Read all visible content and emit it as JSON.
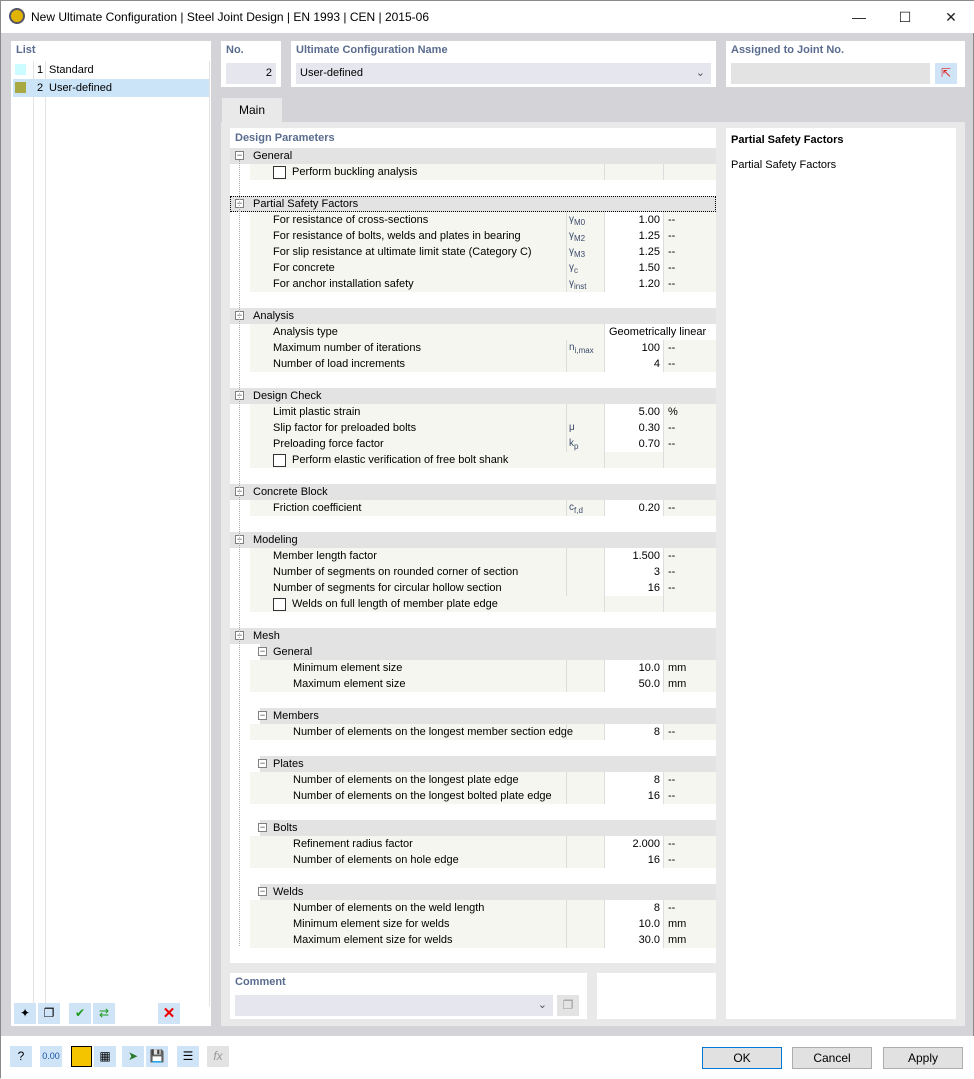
{
  "window": {
    "title": "New Ultimate Configuration | Steel Joint Design | EN 1993 | CEN | 2015-06",
    "minimize": "—",
    "maximize": "☐",
    "close": "✕"
  },
  "list": {
    "header": "List",
    "items": [
      {
        "no": "1",
        "name": "Standard",
        "color": "#ccfcff"
      },
      {
        "no": "2",
        "name": "User-defined",
        "color": "#a9a944",
        "selected": true
      }
    ]
  },
  "number": {
    "label": "No.",
    "value": "2"
  },
  "config_name": {
    "label": "Ultimate Configuration Name",
    "value": "User-defined"
  },
  "assigned": {
    "label": "Assigned to Joint No.",
    "value": ""
  },
  "tabs": [
    {
      "label": "Main",
      "active": true
    }
  ],
  "design_parameters": {
    "title": "Design Parameters",
    "groups": [
      {
        "label": "General",
        "rows": [
          {
            "checkbox": true,
            "checked": false,
            "label": "Perform buckling analysis"
          }
        ]
      },
      {
        "label": "Partial Safety Factors",
        "focused": true,
        "rows": [
          {
            "label": "For resistance of cross-sections",
            "sym": "γ",
            "sub": "M0",
            "value": "1.00",
            "unit": "--"
          },
          {
            "label": "For resistance of bolts, welds and plates in bearing",
            "sym": "γ",
            "sub": "M2",
            "value": "1.25",
            "unit": "--"
          },
          {
            "label": "For slip resistance at ultimate limit state (Category C)",
            "sym": "γ",
            "sub": "M3",
            "value": "1.25",
            "unit": "--"
          },
          {
            "label": "For concrete",
            "sym": "γ",
            "sub": "c",
            "value": "1.50",
            "unit": "--"
          },
          {
            "label": "For anchor installation safety",
            "sym": "γ",
            "sub": "inst",
            "value": "1.20",
            "unit": "--"
          }
        ]
      },
      {
        "label": "Analysis",
        "rows": [
          {
            "label": "Analysis type",
            "value": "Geometrically linear",
            "wide": true
          },
          {
            "label": "Maximum number of iterations",
            "sym": "n",
            "sub": "i,max",
            "value": "100",
            "unit": "--"
          },
          {
            "label": "Number of load increments",
            "value": "4",
            "unit": "--"
          }
        ]
      },
      {
        "label": "Design Check",
        "rows": [
          {
            "label": "Limit plastic strain",
            "value": "5.00",
            "unit": "%"
          },
          {
            "label": "Slip factor for preloaded bolts",
            "sym": "μ",
            "sub": "",
            "value": "0.30",
            "unit": "--"
          },
          {
            "label": "Preloading force factor",
            "sym": "k",
            "sub": "p",
            "value": "0.70",
            "unit": "--"
          },
          {
            "checkbox": true,
            "checked": false,
            "label": "Perform elastic verification of free bolt shank"
          }
        ]
      },
      {
        "label": "Concrete Block",
        "rows": [
          {
            "label": "Friction coefficient",
            "sym": "c",
            "sub": "f,d",
            "value": "0.20",
            "unit": "--"
          }
        ]
      },
      {
        "label": "Modeling",
        "rows": [
          {
            "label": "Member length factor",
            "value": "1.500",
            "unit": "--"
          },
          {
            "label": "Number of segments on rounded corner of section",
            "value": "3",
            "unit": "--"
          },
          {
            "label": "Number of segments for circular hollow section",
            "value": "16",
            "unit": "--"
          },
          {
            "checkbox": true,
            "checked": false,
            "label": "Welds on full length of member plate edge"
          }
        ]
      },
      {
        "label": "Mesh",
        "rows": [],
        "subgroups": [
          {
            "label": "General",
            "rows": [
              {
                "label": "Minimum element size",
                "value": "10.0",
                "unit": "mm"
              },
              {
                "label": "Maximum element size",
                "value": "50.0",
                "unit": "mm"
              }
            ]
          },
          {
            "label": "Members",
            "rows": [
              {
                "label": "Number of elements on the longest member section edge",
                "value": "8",
                "unit": "--"
              }
            ]
          },
          {
            "label": "Plates",
            "rows": [
              {
                "label": "Number of elements on the longest plate edge",
                "value": "8",
                "unit": "--"
              },
              {
                "label": "Number of elements on the longest bolted plate edge",
                "value": "16",
                "unit": "--"
              }
            ]
          },
          {
            "label": "Bolts",
            "rows": [
              {
                "label": "Refinement radius factor",
                "value": "2.000",
                "unit": "--"
              },
              {
                "label": "Number of elements on hole edge",
                "value": "16",
                "unit": "--"
              }
            ]
          },
          {
            "label": "Welds",
            "rows": [
              {
                "label": "Number of elements on the weld length",
                "value": "8",
                "unit": "--"
              },
              {
                "label": "Minimum element size for welds",
                "value": "10.0",
                "unit": "mm"
              },
              {
                "label": "Maximum element size for welds",
                "value": "30.0",
                "unit": "mm"
              }
            ]
          }
        ]
      }
    ]
  },
  "info_panel": {
    "title": "Partial Safety Factors",
    "text": "Partial Safety Factors"
  },
  "comment": {
    "label": "Comment",
    "value": ""
  },
  "buttons": {
    "ok": "OK",
    "cancel": "Cancel",
    "apply": "Apply"
  }
}
